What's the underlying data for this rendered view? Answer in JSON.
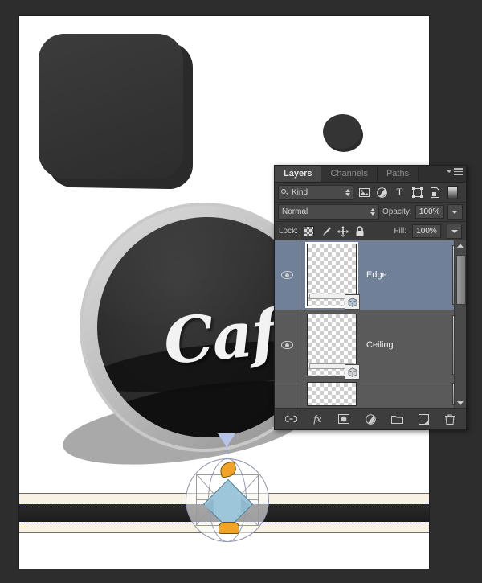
{
  "app": {
    "background_color": "#2d2d2d",
    "canvas_color": "#ffffff"
  },
  "canvas": {
    "artwork_title": "Cafe",
    "cafe_text": "Cafe",
    "elements": [
      {
        "name": "rounded-cube",
        "color": "#333333"
      },
      {
        "name": "small-disc",
        "color": "#343434"
      },
      {
        "name": "cafe-disc",
        "ring_color": "#c9c9c9",
        "face_color": "#2f2f2f"
      },
      {
        "name": "floor-bar",
        "color": "#f7f2e4",
        "stripe_color": "#2b2b2b"
      }
    ]
  },
  "widget": {
    "name": "3d-axis-widget",
    "handle_color": "#f0a326",
    "axis_color": "#9dc6da",
    "cone_color": "#b6c3e8"
  },
  "panel": {
    "tabs": [
      {
        "label": "Layers",
        "active": true
      },
      {
        "label": "Channels",
        "active": false
      },
      {
        "label": "Paths",
        "active": false
      }
    ],
    "menu_icon": "panel-menu-icon",
    "filter": {
      "kind_label": "Kind",
      "search_icon": "search-icon",
      "icons": [
        {
          "name": "filter-pixel-icon",
          "glyph": "▣"
        },
        {
          "name": "filter-adjustment-icon",
          "glyph": "◑"
        },
        {
          "name": "filter-type-icon",
          "glyph": "T"
        },
        {
          "name": "filter-shape-icon",
          "glyph": "⬚"
        },
        {
          "name": "filter-smart-object-icon",
          "glyph": "❐"
        }
      ],
      "toggle_name": "filter-toggle"
    },
    "blend": {
      "mode": "Normal",
      "opacity_label": "Opacity:",
      "opacity_value": "100%"
    },
    "lock": {
      "label": "Lock:",
      "icons": [
        {
          "name": "lock-transparency-icon"
        },
        {
          "name": "lock-image-pixels-icon",
          "glyph": "✐"
        },
        {
          "name": "lock-position-icon",
          "glyph": "✥"
        },
        {
          "name": "lock-all-icon",
          "glyph": "🔒"
        }
      ],
      "fill_label": "Fill:",
      "fill_value": "100%"
    },
    "layers": [
      {
        "name": "Edge",
        "selected": true,
        "visible": true,
        "is_3d": true
      },
      {
        "name": "Ceiling",
        "selected": false,
        "visible": true,
        "is_3d": true
      },
      {
        "name": "",
        "selected": false,
        "visible": true,
        "is_3d": false,
        "partial": true
      }
    ],
    "footer_buttons": [
      {
        "name": "link-layers-button",
        "glyph": "🔗"
      },
      {
        "name": "layer-style-fx-button",
        "glyph": "fx"
      },
      {
        "name": "add-layer-mask-button",
        "glyph": "■"
      },
      {
        "name": "new-adjustment-layer-button",
        "glyph": "◑"
      },
      {
        "name": "new-group-button",
        "glyph": "📁"
      },
      {
        "name": "new-layer-button",
        "glyph": "◥"
      },
      {
        "name": "delete-layer-button",
        "glyph": "🗑"
      }
    ],
    "colors": {
      "panel_bg": "#383838",
      "list_bg": "#5a5a5a",
      "selected_row": "#6f8098"
    }
  }
}
